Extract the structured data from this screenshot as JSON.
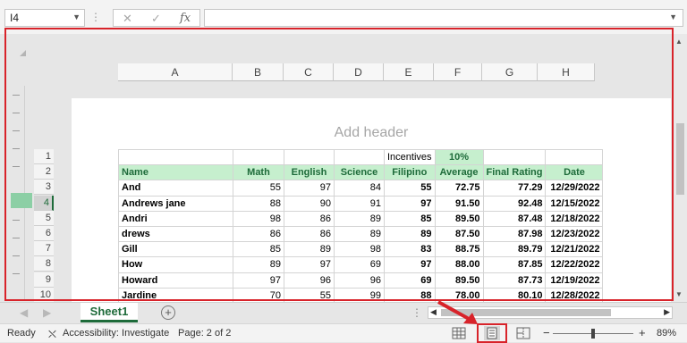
{
  "formula_bar": {
    "name_box": "I4",
    "cancel_icon": "✕",
    "enter_icon": "✓",
    "fx_label": "fx",
    "formula_value": ""
  },
  "columns": [
    "A",
    "B",
    "C",
    "D",
    "E",
    "F",
    "G",
    "H"
  ],
  "page": {
    "header_placeholder": "Add header"
  },
  "row_numbers": [
    "1",
    "2",
    "3",
    "4",
    "5",
    "6",
    "7",
    "8",
    "9",
    "10"
  ],
  "table": {
    "incentives_label": "Incentives",
    "incentives_value": "10%",
    "headers": [
      "Name",
      "Math",
      "English",
      "Science",
      "Filipino",
      "Average",
      "Final Rating",
      "Date"
    ],
    "rows": [
      [
        "And",
        "55",
        "97",
        "84",
        "55",
        "72.75",
        "77.29",
        "12/29/2022"
      ],
      [
        "Andrews jane",
        "88",
        "90",
        "91",
        "97",
        "91.50",
        "92.48",
        "12/15/2022"
      ],
      [
        "Andri",
        "98",
        "86",
        "89",
        "85",
        "89.50",
        "87.48",
        "12/18/2022"
      ],
      [
        "drews",
        "86",
        "86",
        "89",
        "89",
        "87.50",
        "87.98",
        "12/23/2022"
      ],
      [
        "Gill",
        "85",
        "89",
        "98",
        "83",
        "88.75",
        "89.79",
        "12/21/2022"
      ],
      [
        "How",
        "89",
        "97",
        "69",
        "97",
        "88.00",
        "87.85",
        "12/22/2022"
      ],
      [
        "Howard",
        "97",
        "96",
        "96",
        "69",
        "89.50",
        "87.73",
        "12/19/2022"
      ],
      [
        "Jardine",
        "70",
        "55",
        "99",
        "88",
        "78.00",
        "80.10",
        "12/28/2022"
      ]
    ]
  },
  "sheet_tabs": {
    "active": "Sheet1",
    "add_icon": "+"
  },
  "status_bar": {
    "ready": "Ready",
    "accessibility": "Accessibility: Investigate",
    "page_info": "Page: 2 of 2",
    "zoom_minus": "−",
    "zoom_plus": "+",
    "zoom_level": "89%",
    "zoom_fraction": 0.89
  },
  "colors": {
    "accent": "#1e6b3a",
    "header_fill": "#c6efce",
    "highlight_red": "#d8232a"
  }
}
